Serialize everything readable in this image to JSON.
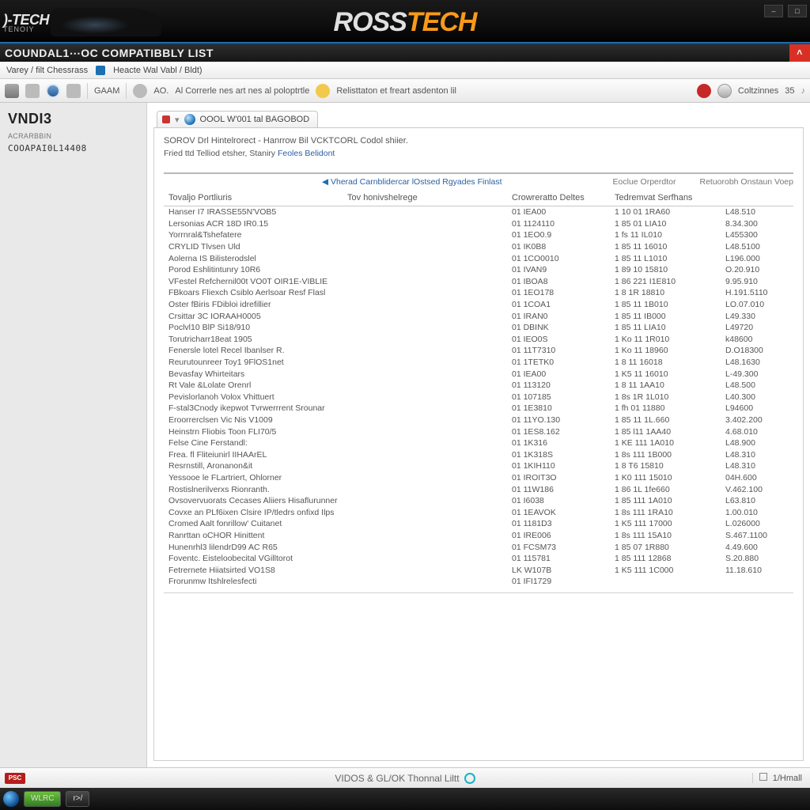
{
  "banner": {
    "small_brand": ")-TECH",
    "small_sub": "TENOIY",
    "center_a": "ROSS",
    "center_b": "TECH"
  },
  "titlebar": {
    "text": "COUNDAL1⋯OC COMPATIBBLY LIST",
    "close_glyph": "˄"
  },
  "menubar": {
    "m1": "Varey / filt Chessrass",
    "m2": "Heacte Wal Vabl / Bldt)"
  },
  "toolbar": {
    "t_gam": "GAAM",
    "t_ao": "AO.",
    "t_mid": "Al Correrle nes art nes al poloptrtle",
    "t_right": "Relisttaton et freart asdenton lil",
    "t_opt": "Coltzinnes",
    "t_count": "35"
  },
  "sidebar": {
    "head": "VNDI3",
    "sub": "ACRARBBIN",
    "code": "COOAPAI0L14408"
  },
  "tab": {
    "label": "OOOL W'001 tal BAGOBOD"
  },
  "panel": {
    "title": "SOROV Drl Hintelrorect - Hanrrow Bil VCKTCORL Codol shiier.",
    "sub_a": "Fried ttd Telliod etsher, Staniry",
    "sub_link": "Feoles Belidont"
  },
  "grid": {
    "caption": "Vherad Carnblidercar lOstsed Rgyades Finlast",
    "cap_r1": "Eoclue Orperdtor",
    "cap_r2": "Retuorobh Onstaun Voep",
    "head_a": "Tovaljo Portliuris",
    "head_a2": "Tov honivshelrege",
    "head_b": "Crowreratto Deltes",
    "head_c": "Tedremvat Serfhans",
    "head_d": "",
    "rows": [
      {
        "a": "Hanser I7 IRASSE55N'VOB5",
        "b": "01  IEA00",
        "c": "1 10   01 1RA60",
        "d": "L48.510"
      },
      {
        "a": "Lersonias ACR 18D IR0.15",
        "b": "01  1124110",
        "c": "1 85   01 LIA10",
        "d": "8.34.300"
      },
      {
        "a": "Yorrnral&Tshefatere",
        "b": "01  1EO0.9",
        "c": "1 fs   11 IL010",
        "d": "L455300"
      },
      {
        "a": "CRYLID Tlvsen Uld",
        "b": "01  IK0B8",
        "c": "1 85   11 16010",
        "d": "L48.5100"
      },
      {
        "a": "Aolerna IS Bilisterodslel",
        "b": "01  1CO0010",
        "c": "1 85   11 L1010",
        "d": "L196.000"
      },
      {
        "a": "Porod Eshlitintunry 10R6",
        "b": "01  IVAN9",
        "c": "1 89   10 15810",
        "d": "O.20.910"
      },
      {
        "a": "VFestel Refchernil00t VO0T OIR1E-VIBLIE",
        "b": "01  IBOA8",
        "c": "1 86   221 I1E810",
        "d": "9.95.910"
      },
      {
        "a": "FBkoars Fliexch Csiblo Aerlsoar Resf Flasl",
        "b": "01  1EO178",
        "c": "1 8   1R  18810",
        "d": "H.191.5110"
      },
      {
        "a": "Oster fBiris FDibloi idrefillier",
        "b": "01  1COA1",
        "c": "1 85   11 1B010",
        "d": "LO.07.010"
      },
      {
        "a": "Crsittar 3C IORAAH0005",
        "b": "01  IRAN0",
        "c": "1 85   11 IB000",
        "d": "L49.330"
      },
      {
        "a": "Poclvl10 BlP Si18/910",
        "b": "01  DBINK",
        "c": "1 85   11 LIA10",
        "d": "L49720"
      },
      {
        "a": "Torutricharr18eat 1905",
        "b": "01  IEO0S",
        "c": "1 Ko   11 1R010",
        "d": "k48600"
      },
      {
        "a": "Fenersle lotel Recel Ibanlser R.",
        "b": "01  11T7310",
        "c": "1 Ko   11 18960",
        "d": "D.O18300"
      },
      {
        "a": "Reurutounreer Toy1 9FlOS1net",
        "b": "01  1TETK0",
        "c": "1 8   11 16018",
        "d": "L48.1630"
      },
      {
        "a": "Bevasfay Whirteitars",
        "b": "01  IEA00",
        "c": "1 K5   11 16010",
        "d": "L-49.300"
      },
      {
        "a": "Rt Vale &Lolate Orenrl",
        "b": "01  113120",
        "c": "1 8   11 1AA10",
        "d": "L48.500"
      },
      {
        "a": "Pevislorlanoh Volox Vhittuert",
        "b": "01  107185",
        "c": "1 8s   1R 1L010",
        "d": "L40.300"
      },
      {
        "a": "F-stal3Cnody ikepwot Tvrwerrrent Srounar",
        "b": "01  1E3810",
        "c": "1 fh   01 11880",
        "d": "L94600"
      },
      {
        "a": "Eroorrerclsen Vic Nis V1009",
        "b": "01  11YO.130",
        "c": "1 85   11 1L.660",
        "d": "3.402.200"
      },
      {
        "a": "Heinstrn Fliobis Toon FLI70/5",
        "b": "01  1ES8.162",
        "c": "1 85   l11 1AA40",
        "d": "4.68.010"
      },
      {
        "a": "Felse Cine Ferstandl:",
        "b": "01  1K316",
        "c": "1 KE   111 1A010",
        "d": "L48.900"
      },
      {
        "a": "Frea. fl   Fliteiunirl IIHAArEL",
        "b": "01  1K318S",
        "c": "1 8s   111 1B000",
        "d": "L48.310"
      },
      {
        "a": "Resrnstill, Aronanon&it",
        "b": "01  1KIH110",
        "c": "1 8   T6 15810",
        "d": "L48.310"
      },
      {
        "a": "Yessooe le FLartriert, Ohlorner",
        "b": "01  IROIT3O",
        "c": "1 K0   111 15010",
        "d": "04H.600"
      },
      {
        "a": "Rostislnerilverxs Rionranth.",
        "b": "01  11W186",
        "c": "1 86   1L 1fe660",
        "d": "V.462.100"
      },
      {
        "a": "Ovsovervuorats Cecases Aliiers Hisaflurunner",
        "b": "01  I6038",
        "c": "1 85   111 1A010",
        "d": "L63.810"
      },
      {
        "a": "Covxe an PLf6ixen Clsire IP/tledrs onfixd Ilps",
        "b": "01  1EAVOK",
        "c": "1 8s   111 1RA10",
        "d": "1.00.010"
      },
      {
        "a": "Cromed Aalt fonrillow' Cuitanet",
        "b": "01  1181D3",
        "c": "1 K5   111 17000",
        "d": "L.026000"
      },
      {
        "a": "Ranrttan oCHOR Hinittent",
        "b": "01  IRE006",
        "c": "1 8s   111 15A10",
        "d": "S.467.1100"
      },
      {
        "a": "Hunenrhl3 lilendrD99 AC R65",
        "b": "01  FCSM73",
        "c": "1 85   07 1R880",
        "d": "4.49.600"
      },
      {
        "a": "Foventc. Eisteloobecital VGilltorot",
        "b": "01  115781",
        "c": "1 85   111 12868",
        "d": "S.20.880"
      },
      {
        "a": "Fetrernete Hiiatsirted VO1S8",
        "b": "LK  W107B",
        "c": "1 K5   111 1C000",
        "d": "11.18.610"
      },
      {
        "a": "Frorunmw Itshlrelesfecti",
        "b": "01 IFI1729",
        "c": "",
        "d": ""
      }
    ]
  },
  "footer": {
    "center": "VIDOS & GL/OK Thonnal Liltt",
    "right": "1/Hmall",
    "left_badge": "PSC"
  },
  "taskbar": {
    "b1": "WLRC",
    "b2": "r>/"
  }
}
